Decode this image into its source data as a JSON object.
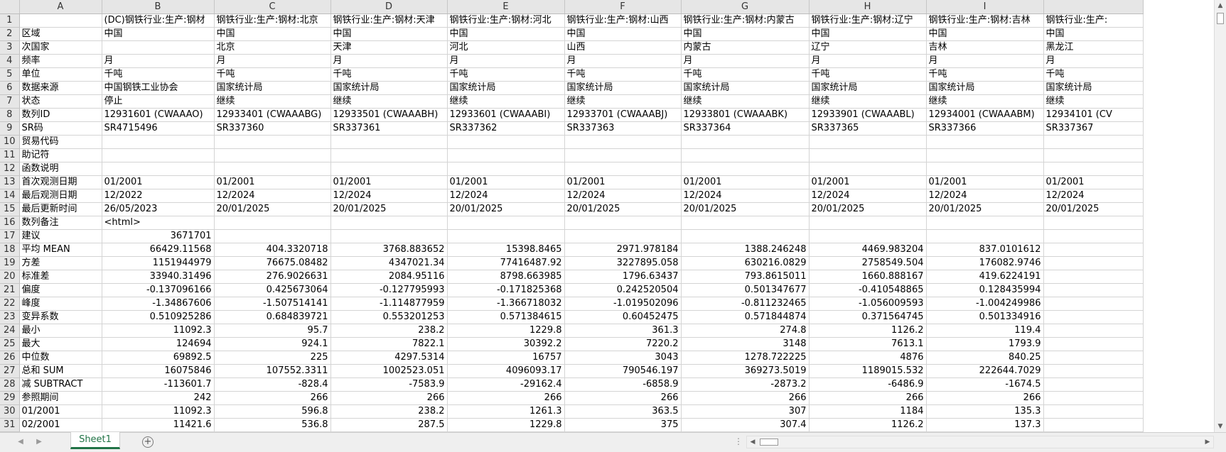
{
  "sheet": {
    "columns": [
      "A",
      "B",
      "C",
      "D",
      "E",
      "F",
      "G",
      "H",
      "I",
      ""
    ],
    "row_labels": [
      "区域",
      "次国家",
      "频率",
      "单位",
      "数据来源",
      "状态",
      "数列ID",
      "SR码",
      "贸易代码",
      "助记符",
      "函数说明",
      "首次观测日期",
      "最后观测日期",
      "最后更新时间",
      "数列备注",
      "建议",
      "平均 MEAN",
      "方差",
      "标准差",
      "偏度",
      "峰度",
      "变异系数",
      "最小",
      "最大",
      "中位数",
      "总和 SUM",
      "减 SUBTRACT",
      "参照期间",
      "01/2001",
      "02/2001"
    ],
    "header_row": [
      "(DC)钢铁行业:生产:钢材",
      "钢铁行业:生产:钢材:北京",
      "钢铁行业:生产:钢材:天津",
      "钢铁行业:生产:钢材:河北",
      "钢铁行业:生产:钢材:山西",
      "钢铁行业:生产:钢材:内蒙古",
      "钢铁行业:生产:钢材:辽宁",
      "钢铁行业:生产:钢材:吉林",
      "钢铁行业:生产:"
    ],
    "rows": [
      [
        "中国",
        "中国",
        "中国",
        "中国",
        "中国",
        "中国",
        "中国",
        "中国",
        "中国"
      ],
      [
        "",
        "北京",
        "天津",
        "河北",
        "山西",
        "内蒙古",
        "辽宁",
        "吉林",
        "黑龙江"
      ],
      [
        "月",
        "月",
        "月",
        "月",
        "月",
        "月",
        "月",
        "月",
        "月"
      ],
      [
        "千吨",
        "千吨",
        "千吨",
        "千吨",
        "千吨",
        "千吨",
        "千吨",
        "千吨",
        "千吨"
      ],
      [
        "中国钢铁工业协会",
        "国家统计局",
        "国家统计局",
        "国家统计局",
        "国家统计局",
        "国家统计局",
        "国家统计局",
        "国家统计局",
        "国家统计局"
      ],
      [
        "停止",
        "继续",
        "继续",
        "继续",
        "继续",
        "继续",
        "继续",
        "继续",
        "继续"
      ],
      [
        "12931601 (CWAAAO)",
        "12933401 (CWAAABG)",
        "12933501 (CWAAABH)",
        "12933601 (CWAAABI)",
        "12933701 (CWAAABJ)",
        "12933801 (CWAAABK)",
        "12933901 (CWAAABL)",
        "12934001 (CWAAABM)",
        "12934101 (CV"
      ],
      [
        "SR4715496",
        "SR337360",
        "SR337361",
        "SR337362",
        "SR337363",
        "SR337364",
        "SR337365",
        "SR337366",
        "SR337367"
      ],
      [
        "",
        "",
        "",
        "",
        "",
        "",
        "",
        "",
        ""
      ],
      [
        "",
        "",
        "",
        "",
        "",
        "",
        "",
        "",
        ""
      ],
      [
        "",
        "",
        "",
        "",
        "",
        "",
        "",
        "",
        ""
      ],
      [
        "01/2001",
        "01/2001",
        "01/2001",
        "01/2001",
        "01/2001",
        "01/2001",
        "01/2001",
        "01/2001",
        "01/2001"
      ],
      [
        "12/2022",
        "12/2024",
        "12/2024",
        "12/2024",
        "12/2024",
        "12/2024",
        "12/2024",
        "12/2024",
        "12/2024"
      ],
      [
        "26/05/2023",
        "20/01/2025",
        "20/01/2025",
        "20/01/2025",
        "20/01/2025",
        "20/01/2025",
        "20/01/2025",
        "20/01/2025",
        "20/01/2025"
      ],
      [
        "<html>",
        "",
        "",
        "",
        "",
        "",
        "",
        "",
        ""
      ],
      [
        "3671701",
        "",
        "",
        "",
        "",
        "",
        "",
        "",
        ""
      ],
      [
        "66429.11568",
        "404.3320718",
        "3768.883652",
        "15398.8465",
        "2971.978184",
        "1388.246248",
        "4469.983204",
        "837.0101612",
        ""
      ],
      [
        "1151944979",
        "76675.08482",
        "4347021.34",
        "77416487.92",
        "3227895.058",
        "630216.0829",
        "2758549.504",
        "176082.9746",
        ""
      ],
      [
        "33940.31496",
        "276.9026631",
        "2084.95116",
        "8798.663985",
        "1796.63437",
        "793.8615011",
        "1660.888167",
        "419.6224191",
        ""
      ],
      [
        "-0.137096166",
        "0.425673064",
        "-0.127795993",
        "-0.171825368",
        "0.242520504",
        "0.501347677",
        "-0.410548865",
        "0.128435994",
        ""
      ],
      [
        "-1.34867606",
        "-1.507514141",
        "-1.114877959",
        "-1.366718032",
        "-1.019502096",
        "-0.811232465",
        "-1.056009593",
        "-1.004249986",
        ""
      ],
      [
        "0.510925286",
        "0.684839721",
        "0.553201253",
        "0.571384615",
        "0.60452475",
        "0.571844874",
        "0.371564745",
        "0.501334916",
        ""
      ],
      [
        "11092.3",
        "95.7",
        "238.2",
        "1229.8",
        "361.3",
        "274.8",
        "1126.2",
        "119.4",
        ""
      ],
      [
        "124694",
        "924.1",
        "7822.1",
        "30392.2",
        "7220.2",
        "3148",
        "7613.1",
        "1793.9",
        ""
      ],
      [
        "69892.5",
        "225",
        "4297.5314",
        "16757",
        "3043",
        "1278.722225",
        "4876",
        "840.25",
        ""
      ],
      [
        "16075846",
        "107552.3311",
        "1002523.051",
        "4096093.17",
        "790546.197",
        "369273.5019",
        "1189015.532",
        "222644.7029",
        ""
      ],
      [
        "-113601.7",
        "-828.4",
        "-7583.9",
        "-29162.4",
        "-6858.9",
        "-2873.2",
        "-6486.9",
        "-1674.5",
        ""
      ],
      [
        "242",
        "266",
        "266",
        "266",
        "266",
        "266",
        "266",
        "266",
        ""
      ],
      [
        "11092.3",
        "596.8",
        "238.2",
        "1261.3",
        "363.5",
        "307",
        "1184",
        "135.3",
        ""
      ],
      [
        "11421.6",
        "536.8",
        "287.5",
        "1229.8",
        "375",
        "307.4",
        "1126.2",
        "137.3",
        ""
      ]
    ]
  },
  "tabs": {
    "active": "Sheet1"
  },
  "icons": {
    "prev": "triangle-left-icon",
    "next": "triangle-right-icon",
    "add": "plus-circle-icon"
  },
  "colors": {
    "accent": "#217346"
  }
}
